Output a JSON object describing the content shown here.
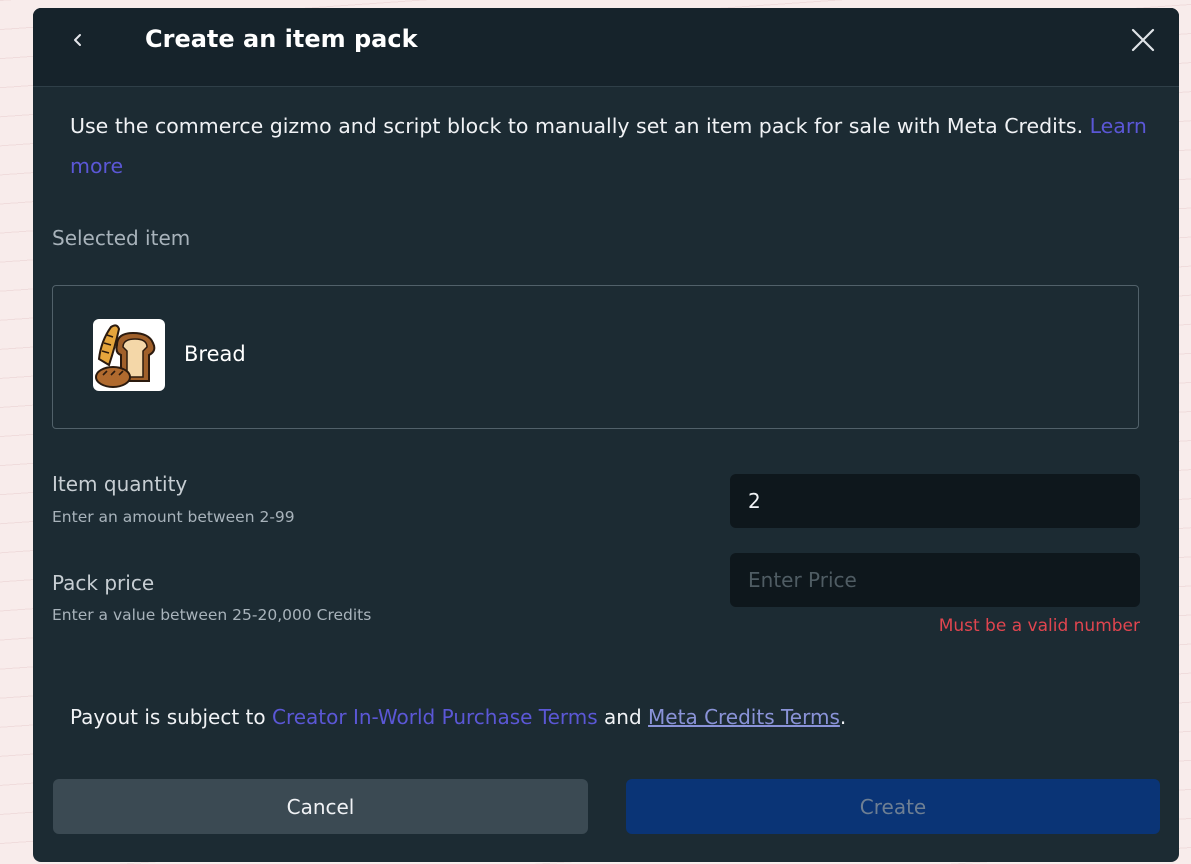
{
  "dialog": {
    "title": "Create an item pack",
    "description": "Use the commerce gizmo and script block to manually set an item pack for sale with Meta Credits.",
    "learn_more": "Learn more"
  },
  "selected_item": {
    "label": "Selected item",
    "name": "Bread"
  },
  "quantity": {
    "label": "Item quantity",
    "hint": "Enter an amount between 2-99",
    "value": "2"
  },
  "price": {
    "label": "Pack price",
    "hint": "Enter a value between 25-20,000 Credits",
    "value": "",
    "placeholder": "Enter Price",
    "error": "Must be a valid number"
  },
  "payout": {
    "prefix": "Payout is subject to",
    "link1": "Creator In-World Purchase Terms",
    "and": "and",
    "link2": "Meta Credits Terms",
    "suffix": "."
  },
  "buttons": {
    "cancel": "Cancel",
    "create": "Create"
  },
  "icons": {
    "back": "chevron-left-icon",
    "close": "close-icon",
    "item": "bread-icon"
  },
  "colors": {
    "dialog_bg": "#1c2b33",
    "link": "#5b57d6",
    "error": "#e0454f",
    "create_button": "#0a3476",
    "cancel_button": "#3b4a53"
  }
}
